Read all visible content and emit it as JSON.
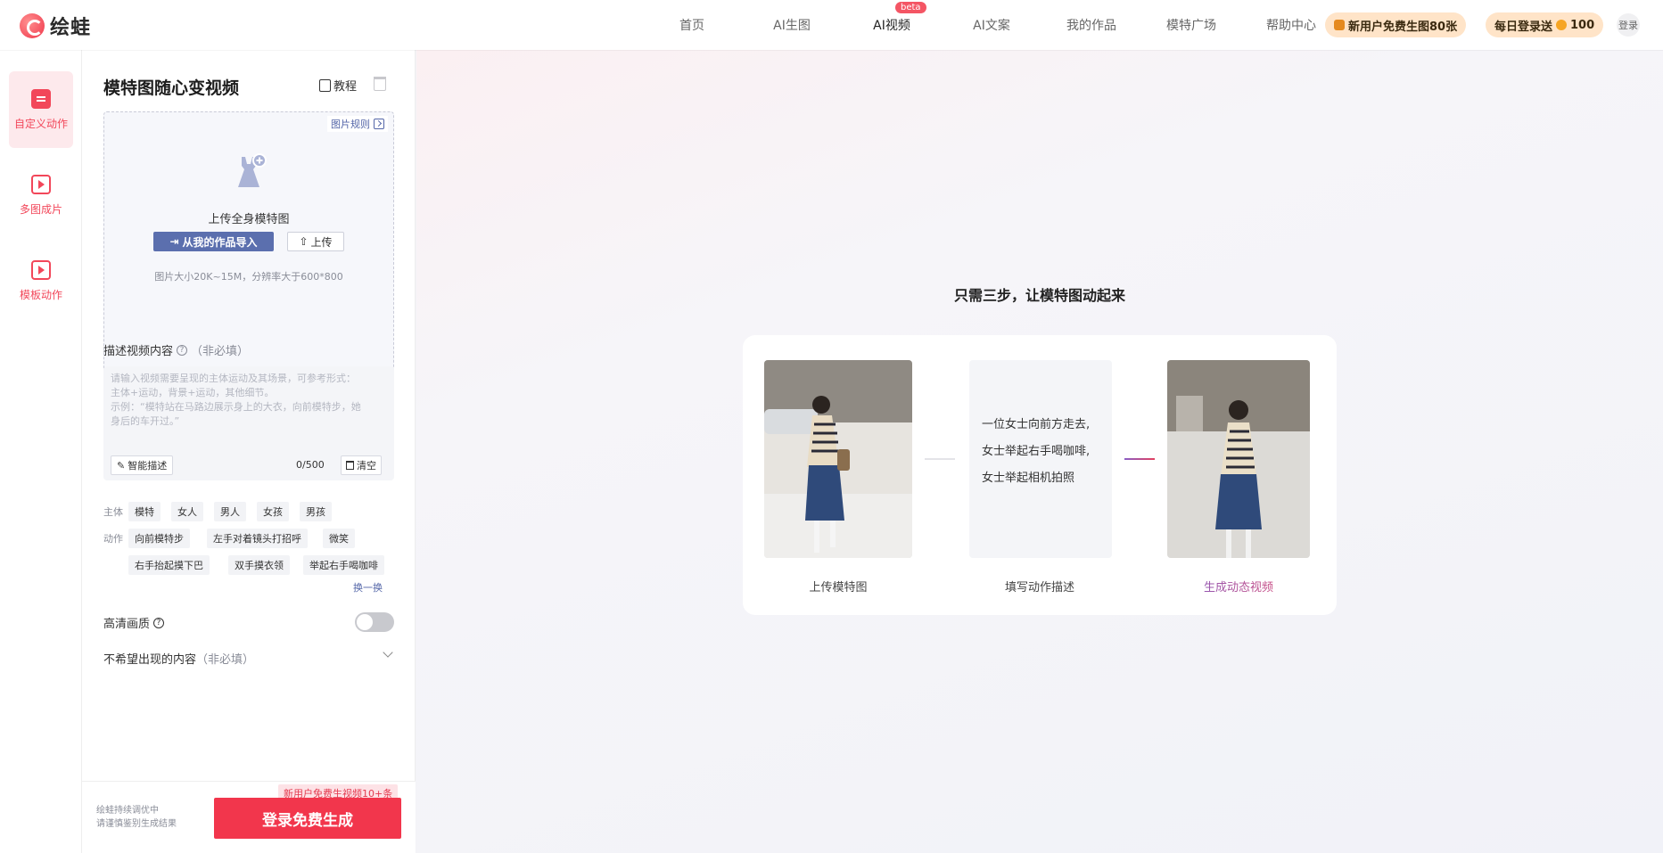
{
  "brand": {
    "name": "绘蛙"
  },
  "nav": {
    "items": [
      {
        "label": "首页"
      },
      {
        "label": "AI生图"
      },
      {
        "label": "AI视频",
        "badge": "beta",
        "active": true
      },
      {
        "label": "AI文案"
      },
      {
        "label": "我的作品"
      },
      {
        "label": "模特广场"
      },
      {
        "label": "帮助中心"
      }
    ],
    "promo_new_user": "新用户免费生图80张",
    "daily_login": "每日登录送",
    "daily_login_amount": "100",
    "login": "登录"
  },
  "rail": {
    "items": [
      {
        "label": "自定义动作",
        "active": true
      },
      {
        "label": "多图成片"
      },
      {
        "label": "模板动作"
      }
    ]
  },
  "panel": {
    "title": "模特图随心变视频",
    "tutorial": "教程",
    "upload": {
      "rule_link": "图片规则",
      "label": "上传全身模特图",
      "import_button": "从我的作品导入",
      "upload_button": "上传",
      "hint": "图片大小20K~15M，分辨率大于600*800"
    },
    "description": {
      "label": "描述视频内容",
      "optional": "（非必填）",
      "placeholder_line1": "请输入视频需要呈现的主体运动及其场景，可参考形式：",
      "placeholder_line2": "主体+运动，背景+运动，其他细节。",
      "placeholder_line3": "示例：“模特站在马路边展示身上的大衣，向前模特步，她",
      "placeholder_line4": "身后的车开过。”",
      "smart_button": "智能描述",
      "counter": "0/500",
      "clear_button": "清空"
    },
    "subject_label": "主体",
    "subject_tags": [
      "模特",
      "女人",
      "男人",
      "女孩",
      "男孩"
    ],
    "action_label": "动作",
    "action_tags_row1": [
      "向前模特步",
      "左手对着镜头打招呼",
      "微笑"
    ],
    "action_tags_row2": [
      "右手抬起摸下巴",
      "双手摸衣领",
      "举起右手喝咖啡"
    ],
    "swap": "换一换",
    "hd_label": "高清画质",
    "hd_enabled": false,
    "negative_label": "不希望出现的内容",
    "negative_optional": "（非必填）"
  },
  "footer": {
    "note_line1": "绘蛙持续调优中",
    "note_line2": "请谨慎鉴别生成结果",
    "promo": "新用户免费生视频10+条",
    "login_button": "登录免费生成"
  },
  "main": {
    "title": "只需三步，让模特图动起来",
    "steps": [
      {
        "label": "上传模特图"
      },
      {
        "label": "填写动作描述"
      },
      {
        "label": "生成动态视频"
      }
    ],
    "example_text": [
      "一位女士向前方走去,",
      "女士举起右手喝咖啡,",
      "女士举起相机拍照"
    ]
  },
  "colors": {
    "accent": "#f2364c",
    "import_button": "#5b6fae",
    "link": "#5466a8",
    "promo_pill": "#ffe4c8"
  }
}
